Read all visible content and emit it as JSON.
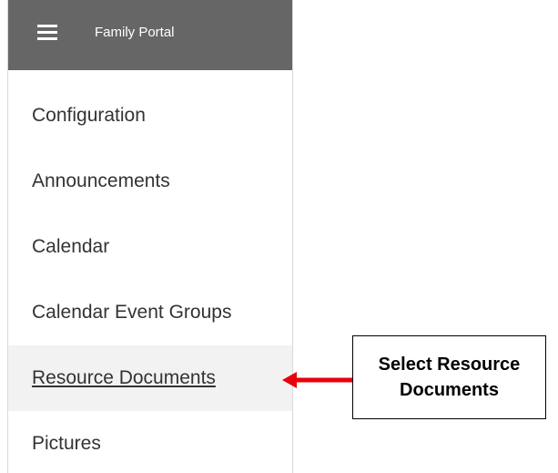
{
  "header": {
    "title": "Family Portal",
    "menu_icon": "hamburger-menu-icon",
    "background_color": "#666666"
  },
  "nav": {
    "items": [
      {
        "label": "Configuration"
      },
      {
        "label": "Announcements"
      },
      {
        "label": "Calendar"
      },
      {
        "label": "Calendar Event Groups"
      },
      {
        "label": "Resource Documents",
        "active": true
      },
      {
        "label": "Pictures"
      }
    ]
  },
  "annotation": {
    "text": "Select Resource Documents",
    "arrow_color": "#e8000b",
    "arrow_icon": "arrow-left-icon"
  }
}
